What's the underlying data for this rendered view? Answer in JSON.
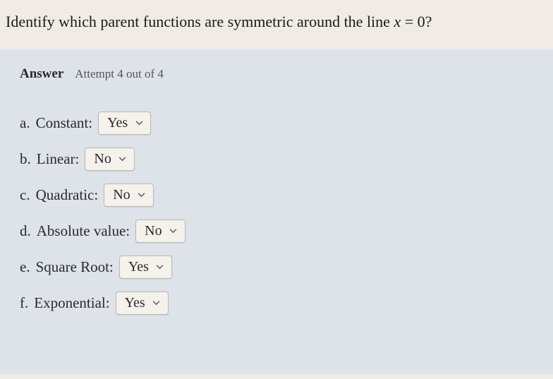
{
  "question": {
    "prefix": "Identify which parent functions are symmetric around the line ",
    "var": "x",
    "suffix": " = 0?"
  },
  "answer": {
    "label": "Answer",
    "attempt": "Attempt 4 out of 4"
  },
  "items": [
    {
      "letter": "a.",
      "label": "Constant:",
      "value": "Yes"
    },
    {
      "letter": "b.",
      "label": "Linear:",
      "value": "No"
    },
    {
      "letter": "c.",
      "label": "Quadratic:",
      "value": "No"
    },
    {
      "letter": "d.",
      "label": "Absolute value:",
      "value": "No"
    },
    {
      "letter": "e.",
      "label": "Square Root:",
      "value": "Yes"
    },
    {
      "letter": "f.",
      "label": "Exponential:",
      "value": "Yes"
    }
  ]
}
